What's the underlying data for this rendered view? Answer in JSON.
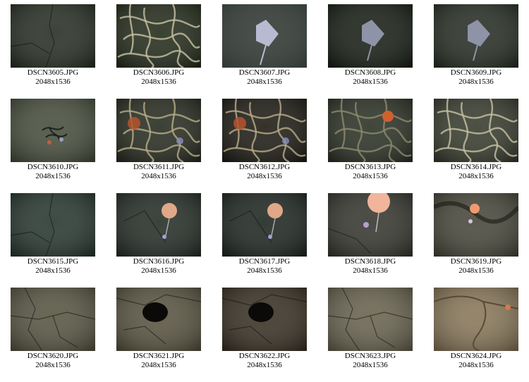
{
  "gallery": {
    "items": [
      {
        "filename": "DSCN3605.JPG",
        "dims": "2048x1536",
        "bg": "#2b3227",
        "scene": "rock-dark"
      },
      {
        "filename": "DSCN3606.JPG",
        "dims": "2048x1536",
        "bg": "#27301f",
        "scene": "tubeworms"
      },
      {
        "filename": "DSCN3607.JPG",
        "dims": "2048x1536",
        "bg": "#3a3f33",
        "scene": "skate-bright"
      },
      {
        "filename": "DSCN3608.JPG",
        "dims": "2048x1536",
        "bg": "#1b2118",
        "scene": "skate-dark"
      },
      {
        "filename": "DSCN3609.JPG",
        "dims": "2048x1536",
        "bg": "#2a3127",
        "scene": "skate-dark"
      },
      {
        "filename": "DSCN3610.JPG",
        "dims": "2048x1536",
        "bg": "#4a5140",
        "scene": "worm-cluster"
      },
      {
        "filename": "DSCN3611.JPG",
        "dims": "2048x1536",
        "bg": "#2a2f23",
        "scene": "tubeworms-red"
      },
      {
        "filename": "DSCN3612.JPG",
        "dims": "2048x1536",
        "bg": "#221f18",
        "scene": "tubeworms-red"
      },
      {
        "filename": "DSCN3613.JPG",
        "dims": "2048x1536",
        "bg": "#2f3529",
        "scene": "coral-orange"
      },
      {
        "filename": "DSCN3614.JPG",
        "dims": "2048x1536",
        "bg": "#3b3f31",
        "scene": "tubeworms"
      },
      {
        "filename": "DSCN3615.JPG",
        "dims": "2048x1536",
        "bg": "#2b3a33",
        "scene": "rock-dark"
      },
      {
        "filename": "DSCN3616.JPG",
        "dims": "2048x1536",
        "bg": "#28312a",
        "scene": "coral-peach"
      },
      {
        "filename": "DSCN3617.JPG",
        "dims": "2048x1536",
        "bg": "#222a24",
        "scene": "coral-peach"
      },
      {
        "filename": "DSCN3618.JPG",
        "dims": "2048x1536",
        "bg": "#3a3a33",
        "scene": "coral-bright"
      },
      {
        "filename": "DSCN3619.JPG",
        "dims": "2048x1536",
        "bg": "#4b4a3e",
        "scene": "coral-small"
      },
      {
        "filename": "DSCN3620.JPG",
        "dims": "2048x1536",
        "bg": "#5a5845",
        "scene": "sand-cracks"
      },
      {
        "filename": "DSCN3621.JPG",
        "dims": "2048x1536",
        "bg": "#5c5744",
        "scene": "hole"
      },
      {
        "filename": "DSCN3622.JPG",
        "dims": "2048x1536",
        "bg": "#3c3427",
        "scene": "hole"
      },
      {
        "filename": "DSCN3623.JPG",
        "dims": "2048x1536",
        "bg": "#6b6652",
        "scene": "sand-cracks"
      },
      {
        "filename": "DSCN3624.JPG",
        "dims": "2048x1536",
        "bg": "#8b7a5c",
        "scene": "sand-bright"
      }
    ]
  }
}
